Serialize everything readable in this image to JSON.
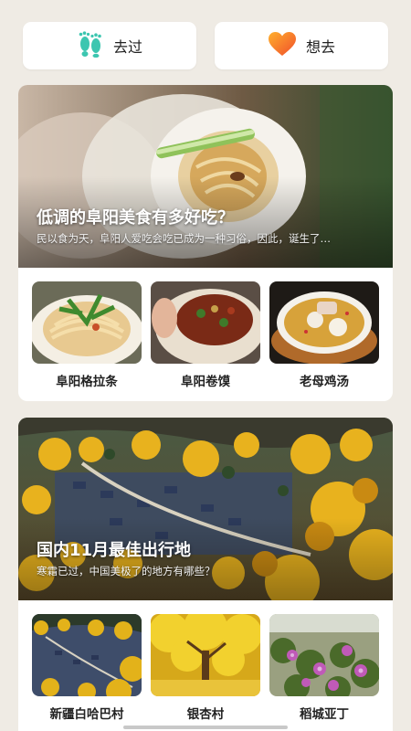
{
  "top_buttons": {
    "visited": {
      "label": "去过",
      "icon": "footprints-icon",
      "color": "#3cc6b0"
    },
    "want": {
      "label": "想去",
      "icon": "heart-icon",
      "color": "#f2632a"
    }
  },
  "articles": [
    {
      "title": "低调的阜阳美食有多好吃？",
      "subtitle": "民以食为天，阜阳人爱吃会吃已成为一种习俗，因此，诞生了…",
      "items": [
        {
          "label": "阜阳格拉条"
        },
        {
          "label": "阜阳卷馍"
        },
        {
          "label": "老母鸡汤"
        }
      ]
    },
    {
      "title": "国内11月最佳出行地",
      "subtitle": "寒霜已过，中国美极了的地方有哪些？",
      "items": [
        {
          "label": "新疆白哈巴村"
        },
        {
          "label": "银杏村"
        },
        {
          "label": "稻城亚丁"
        }
      ]
    }
  ]
}
